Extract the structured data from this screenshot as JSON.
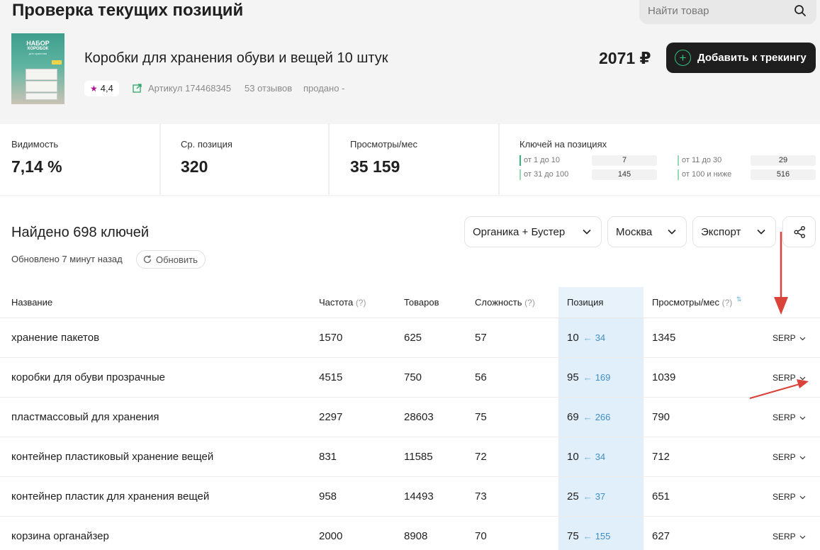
{
  "page": {
    "title": "Проверка текущих позиций",
    "search_placeholder": "Найти товар"
  },
  "product": {
    "image_text_1": "НАБОР",
    "image_text_2": "КОРОБОК",
    "image_text_3": "для хранения",
    "name": "Коробки для хранения обуви и вещей 10 штук",
    "rating": "4,4",
    "article": "Артикул 174468345",
    "reviews": "53 отзывов",
    "sold": "продано -",
    "price": "2071 ₽",
    "track_button": "Добавить к трекингу"
  },
  "stats": {
    "visibility": {
      "label": "Видимость",
      "value": "7,14 %"
    },
    "avg_position": {
      "label": "Ср. позиция",
      "value": "320"
    },
    "views": {
      "label": "Просмотры/мес",
      "value": "35 159"
    },
    "keys": {
      "label": "Ключей на позициях",
      "ranges": [
        {
          "label": "от 1 до 10",
          "value": "7"
        },
        {
          "label": "от 11 до 30",
          "value": "29"
        },
        {
          "label": "от 31 до 100",
          "value": "145"
        },
        {
          "label": "от 100 и ниже",
          "value": "516"
        }
      ]
    }
  },
  "toolbar": {
    "found": "Найдено 698 ключей",
    "updated": "Обновлено 7 минут назад",
    "refresh": "Обновить",
    "filter_source": "Органика + Бустер",
    "filter_city": "Москва",
    "export": "Экспорт"
  },
  "table": {
    "headers": {
      "name": "Название",
      "frequency": "Частота",
      "products": "Товаров",
      "difficulty": "Сложность",
      "position": "Позиция",
      "views": "Просмотры/мес",
      "help": "(?)"
    },
    "serp_label": "SERP",
    "rows": [
      {
        "name": "хранение пакетов",
        "frequency": "1570",
        "products": "625",
        "difficulty": "57",
        "position": "10",
        "prev": "34",
        "views": "1345"
      },
      {
        "name": "коробки для обуви прозрачные",
        "frequency": "4515",
        "products": "750",
        "difficulty": "56",
        "position": "95",
        "prev": "169",
        "views": "1039"
      },
      {
        "name": "пластмассовый для хранения",
        "frequency": "2297",
        "products": "28603",
        "difficulty": "75",
        "position": "69",
        "prev": "266",
        "views": "790"
      },
      {
        "name": "контейнер пластиковый хранение вещей",
        "frequency": "831",
        "products": "11585",
        "difficulty": "72",
        "position": "10",
        "prev": "34",
        "views": "712"
      },
      {
        "name": "контейнер пластик для хранения вещей",
        "frequency": "958",
        "products": "14493",
        "difficulty": "73",
        "position": "25",
        "prev": "37",
        "views": "651"
      },
      {
        "name": "корзина органайзер",
        "frequency": "2000",
        "products": "8908",
        "difficulty": "70",
        "position": "75",
        "prev": "155",
        "views": "627"
      }
    ]
  },
  "colors": {
    "accent_green": "#2ec27e",
    "position_column": "#e1effb",
    "annotation_arrow": "#d9433a",
    "rating_star": "#b2148e"
  }
}
